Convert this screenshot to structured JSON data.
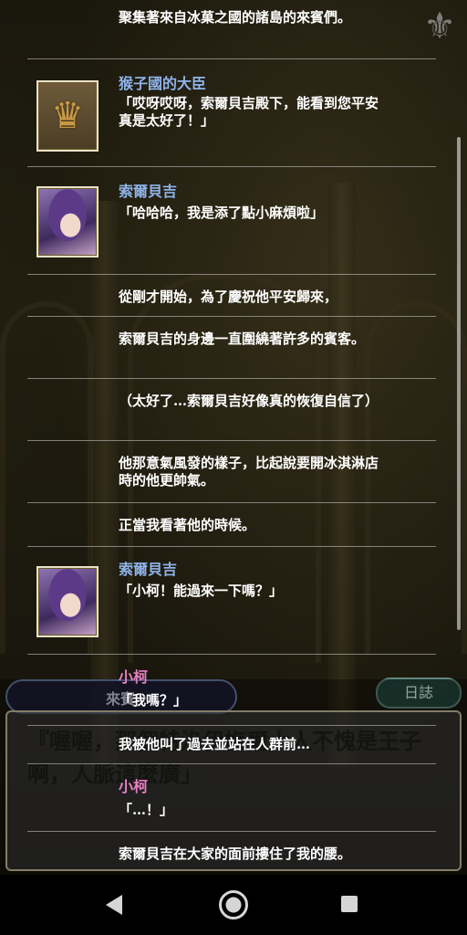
{
  "log": {
    "entries": [
      {
        "type": "narration",
        "text": "聚集著來自冰菓之國的諸島的來賓們。"
      },
      {
        "type": "dialogue",
        "speaker": "猴子國的大臣",
        "speaker_color": "#8fb4ea",
        "portrait": "crown-icon",
        "text": "「哎呀哎呀，索爾貝吉殿下，能看到您平安真是太好了！」"
      },
      {
        "type": "dialogue",
        "speaker": "索爾貝吉",
        "speaker_color": "#8fb4ea",
        "portrait": "character-portrait",
        "text": "「哈哈哈，我是添了點小麻煩啦」"
      },
      {
        "type": "narration",
        "text": "從剛才開始，為了慶祝他平安歸來，"
      },
      {
        "type": "narration",
        "text": "索爾貝吉的身邊一直圍繞著許多的賓客。"
      },
      {
        "type": "narration",
        "text": "（太好了…索爾貝吉好像真的恢復自信了）"
      },
      {
        "type": "narration",
        "text": "他那意氣風發的樣子，比起說要開冰淇淋店時的他更帥氣。"
      },
      {
        "type": "narration",
        "text": "正當我看著他的時候。"
      },
      {
        "type": "dialogue",
        "speaker": "索爾貝吉",
        "speaker_color": "#8fb4ea",
        "portrait": "character-portrait",
        "text": "「小柯！能過來一下嗎？」"
      },
      {
        "type": "dialogue",
        "speaker": "小柯",
        "speaker_color": "#e77fc2",
        "text": "「我嗎？」"
      },
      {
        "type": "narration",
        "text": "我被他叫了過去並站在人群前…"
      },
      {
        "type": "dialogue",
        "speaker": "小柯",
        "speaker_color": "#e77fc2",
        "text": "「…！」"
      },
      {
        "type": "narration",
        "text": "索爾貝吉在大家的面前摟住了我的腰。"
      }
    ]
  },
  "dialog": {
    "name": "來賓",
    "text": "『喔喔，那個特洛伊梅爾大人不愧是王子啊，人脈這麼廣」"
  },
  "log_button": {
    "label": "日誌"
  },
  "navbar": {
    "back": "back-icon",
    "home": "home-icon",
    "recent": "recent-apps-icon"
  }
}
